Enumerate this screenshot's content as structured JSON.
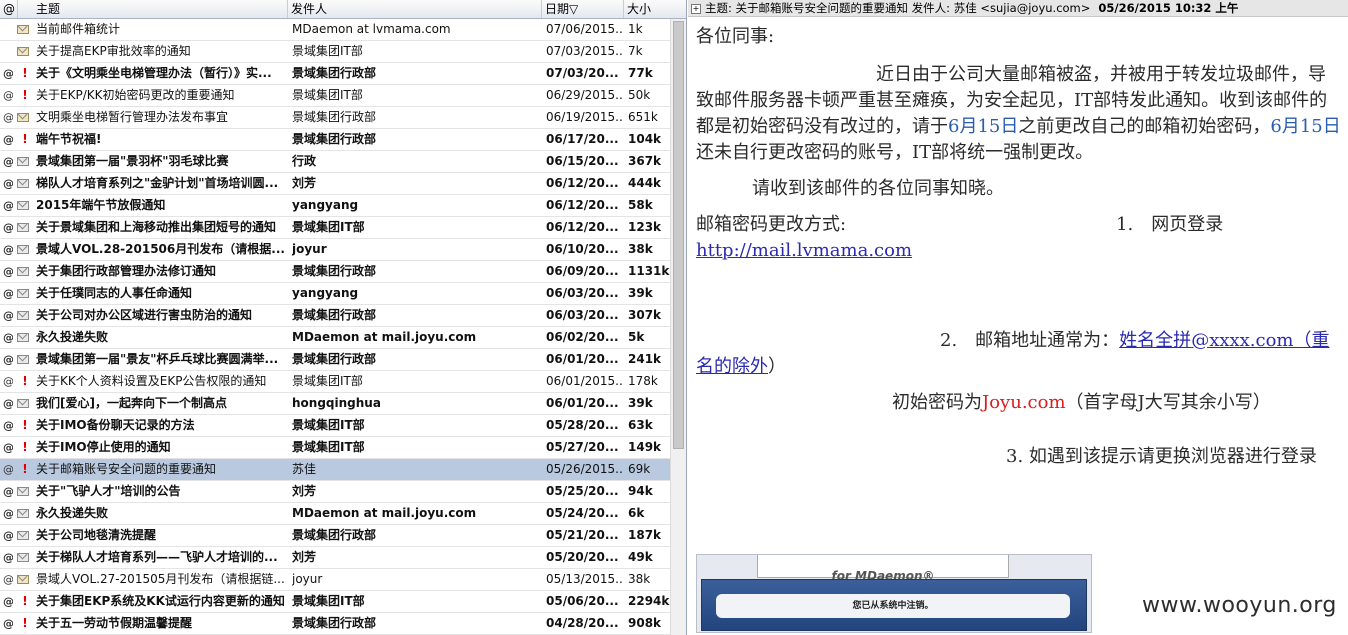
{
  "columns": {
    "attach": "@",
    "subject": "主题",
    "from": "发件人",
    "date": "日期▽",
    "size": "大小"
  },
  "messages": [
    {
      "attach": "",
      "flag": "",
      "icon": "open",
      "unread": false,
      "selected": false,
      "subject": "当前邮件箱统计",
      "from": "MDaemon at lvmama.com",
      "date": "07/06/2015...",
      "size": "1k"
    },
    {
      "attach": "",
      "flag": "",
      "icon": "open",
      "unread": false,
      "selected": false,
      "subject": "关于提高EKP审批效率的通知",
      "from": "景域集团IT部",
      "date": "07/03/2015...",
      "size": "7k"
    },
    {
      "attach": "@",
      "flag": "!",
      "icon": "",
      "unread": true,
      "selected": false,
      "subject": "关于《文明乘坐电梯管理办法（暂行）》实...",
      "from": "景域集团行政部",
      "date": "07/03/20...",
      "size": "77k"
    },
    {
      "attach": "@",
      "flag": "!",
      "icon": "",
      "unread": false,
      "selected": false,
      "subject": "关于EKP/KK初始密码更改的重要通知",
      "from": "景域集团IT部",
      "date": "06/29/2015...",
      "size": "50k"
    },
    {
      "attach": "@",
      "flag": "",
      "icon": "open",
      "unread": false,
      "selected": false,
      "subject": "文明乘坐电梯暂行管理办法发布事宜",
      "from": "景域集团行政部",
      "date": "06/19/2015...",
      "size": "651k"
    },
    {
      "attach": "@",
      "flag": "!",
      "icon": "",
      "unread": true,
      "selected": false,
      "subject": "端午节祝福!",
      "from": "景域集团行政部",
      "date": "06/17/20...",
      "size": "104k"
    },
    {
      "attach": "@",
      "flag": "",
      "icon": "closed",
      "unread": true,
      "selected": false,
      "subject": "景域集团第一届\"景羽杯\"羽毛球比赛",
      "from": "行政",
      "date": "06/15/20...",
      "size": "367k"
    },
    {
      "attach": "@",
      "flag": "",
      "icon": "closed",
      "unread": true,
      "selected": false,
      "subject": "梯队人才培育系列之\"金驴计划\"首场培训圆...",
      "from": "刘芳",
      "date": "06/12/20...",
      "size": "444k"
    },
    {
      "attach": "@",
      "flag": "",
      "icon": "closed",
      "unread": true,
      "selected": false,
      "subject": "2015年端午节放假通知",
      "from": "yangyang",
      "date": "06/12/20...",
      "size": "58k"
    },
    {
      "attach": "@",
      "flag": "",
      "icon": "closed",
      "unread": true,
      "selected": false,
      "subject": "关于景域集团和上海移动推出集团短号的通知",
      "from": "景域集团IT部",
      "date": "06/12/20...",
      "size": "123k"
    },
    {
      "attach": "@",
      "flag": "",
      "icon": "closed",
      "unread": true,
      "selected": false,
      "subject": "景域人VOL.28-201506月刊发布（请根据...",
      "from": "joyur",
      "date": "06/10/20...",
      "size": "38k"
    },
    {
      "attach": "@",
      "flag": "",
      "icon": "closed",
      "unread": true,
      "selected": false,
      "subject": "关于集团行政部管理办法修订通知",
      "from": "景域集团行政部",
      "date": "06/09/20...",
      "size": "1131k"
    },
    {
      "attach": "@",
      "flag": "",
      "icon": "closed",
      "unread": true,
      "selected": false,
      "subject": "关于任璞同志的人事任命通知",
      "from": "yangyang",
      "date": "06/03/20...",
      "size": "39k"
    },
    {
      "attach": "@",
      "flag": "",
      "icon": "closed",
      "unread": true,
      "selected": false,
      "subject": "关于公司对办公区域进行害虫防治的通知",
      "from": "景域集团行政部",
      "date": "06/03/20...",
      "size": "307k"
    },
    {
      "attach": "@",
      "flag": "",
      "icon": "closed",
      "unread": true,
      "selected": false,
      "subject": "永久投递失败",
      "from": "MDaemon at mail.joyu.com",
      "date": "06/02/20...",
      "size": "5k"
    },
    {
      "attach": "@",
      "flag": "",
      "icon": "closed",
      "unread": true,
      "selected": false,
      "subject": "景域集团第一届\"景友\"杯乒乓球比赛圆满举...",
      "from": "景域集团行政部",
      "date": "06/01/20...",
      "size": "241k"
    },
    {
      "attach": "@",
      "flag": "!",
      "icon": "",
      "unread": false,
      "selected": false,
      "subject": "关于KK个人资料设置及EKP公告权限的通知",
      "from": "景域集团IT部",
      "date": "06/01/2015...",
      "size": "178k"
    },
    {
      "attach": "@",
      "flag": "",
      "icon": "closed",
      "unread": true,
      "selected": false,
      "subject": "我们[爱心]，一起奔向下一个制高点",
      "from": "hongqinghua",
      "date": "06/01/20...",
      "size": "39k"
    },
    {
      "attach": "@",
      "flag": "!",
      "icon": "",
      "unread": true,
      "selected": false,
      "subject": "关于IMO备份聊天记录的方法",
      "from": "景域集团IT部",
      "date": "05/28/20...",
      "size": "63k"
    },
    {
      "attach": "@",
      "flag": "!",
      "icon": "",
      "unread": true,
      "selected": false,
      "subject": "关于IMO停止使用的通知",
      "from": "景域集团IT部",
      "date": "05/27/20...",
      "size": "149k"
    },
    {
      "attach": "@",
      "flag": "!",
      "icon": "",
      "unread": false,
      "selected": true,
      "subject": "关于邮箱账号安全问题的重要通知",
      "from": "苏佳",
      "date": "05/26/2015...",
      "size": "69k"
    },
    {
      "attach": "@",
      "flag": "",
      "icon": "closed",
      "unread": true,
      "selected": false,
      "subject": "关于\"飞驴人才\"培训的公告",
      "from": "刘芳",
      "date": "05/25/20...",
      "size": "94k"
    },
    {
      "attach": "@",
      "flag": "",
      "icon": "closed",
      "unread": true,
      "selected": false,
      "subject": "永久投递失败",
      "from": "MDaemon at mail.joyu.com",
      "date": "05/24/20...",
      "size": "6k"
    },
    {
      "attach": "@",
      "flag": "",
      "icon": "closed",
      "unread": true,
      "selected": false,
      "subject": "关于公司地毯清洗提醒",
      "from": "景域集团行政部",
      "date": "05/21/20...",
      "size": "187k"
    },
    {
      "attach": "@",
      "flag": "",
      "icon": "closed",
      "unread": true,
      "selected": false,
      "subject": "关于梯队人才培育系列——飞驴人才培训的...",
      "from": "刘芳",
      "date": "05/20/20...",
      "size": "49k"
    },
    {
      "attach": "@",
      "flag": "",
      "icon": "open",
      "unread": false,
      "selected": false,
      "subject": "景域人VOL.27-201505月刊发布（请根据链...",
      "from": "joyur",
      "date": "05/13/2015...",
      "size": "38k"
    },
    {
      "attach": "@",
      "flag": "!",
      "icon": "",
      "unread": true,
      "selected": false,
      "subject": "关于集团EKP系统及KK试运行内容更新的通知",
      "from": "景域集团IT部",
      "date": "05/06/20...",
      "size": "2294k"
    },
    {
      "attach": "@",
      "flag": "!",
      "icon": "",
      "unread": true,
      "selected": false,
      "subject": "关于五一劳动节假期温馨提醒",
      "from": "景域集团行政部",
      "date": "04/28/20...",
      "size": "908k"
    }
  ],
  "preview": {
    "header_expand": "+",
    "header_text": "主题: 关于邮箱账号安全问题的重要通知 发件人: 苏佳 <sujia@joyu.com>",
    "header_date": "05/26/2015 10:32 上午",
    "greeting": "各位同事:",
    "p1_a": "近日由于公司大量邮箱被盗，并被用于转发垃圾邮件，导致邮件服务器卡顿严重甚至瘫痪，为安全起见，IT部特发此通知。收到该邮件的都是初始密码没有改过的，请于",
    "p1_date1": "6月15日",
    "p1_b": "之前更改自己的邮箱初始密码，",
    "p1_date2": "6月15日",
    "p1_c": "还未自行更改密码的账号，IT部将统一强制更改。",
    "p2": "请收到该邮件的各位同事知晓。",
    "p3_label": "邮箱密码更改方式:",
    "p3_item1": "1.　网页登录",
    "p3_link": "http://mail.lvmama.com",
    "p4_item2": "2.　邮箱地址通常为：",
    "p4_link": "姓名全拼",
    "p4_domain": "@xxxx.com（重名的除外",
    "p4_close": "）",
    "p5_a": "初始密码为",
    "p5_pw": "Joyu.com",
    "p5_b": "（首字母J大写其余小写）",
    "p6": "3. 如遇到该提示请更换浏览器进行登录",
    "embedded_title": "for MDaemon®",
    "embedded_msg": "您已从系统中注销。"
  },
  "watermark": "www.wooyun.org"
}
